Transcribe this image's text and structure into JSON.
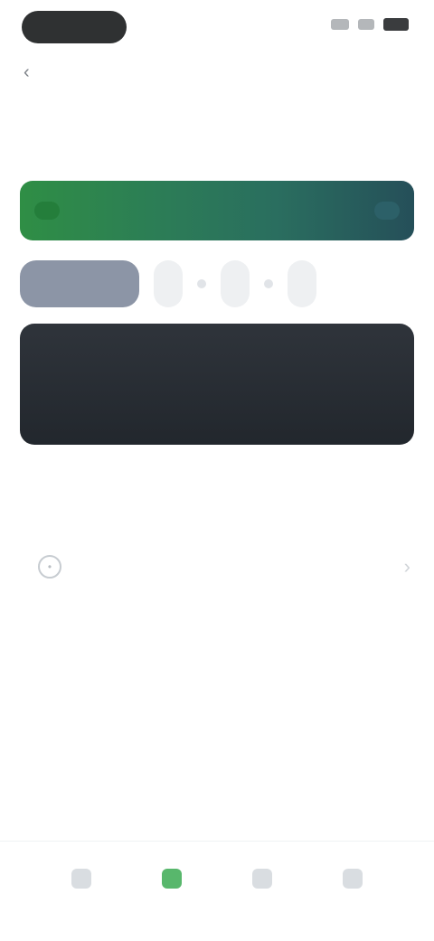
{
  "status_bar": {
    "time": "",
    "icons": [
      "signal-icon",
      "wifi-icon",
      "battery-icon"
    ]
  },
  "header": {
    "back_label": "",
    "title": ""
  },
  "promo": {
    "badge": "",
    "text": "",
    "cta": "",
    "colors": {
      "start": "#2f8e45",
      "end": "#254f59"
    }
  },
  "filters": {
    "chips": [
      {
        "label": "",
        "active": true
      },
      {
        "label": "",
        "active": false
      },
      {
        "label": "",
        "active": false
      },
      {
        "label": "",
        "active": false
      }
    ]
  },
  "feature_card": {
    "heading": "",
    "subtext": ""
  },
  "section": {
    "title": ""
  },
  "list": {
    "items": [
      {
        "title": "",
        "subtitle": "",
        "icon": "circle-icon"
      }
    ]
  },
  "bottom_nav": {
    "items": [
      {
        "label": "",
        "icon": "home-icon",
        "active": false
      },
      {
        "label": "",
        "icon": "explore-icon",
        "active": true
      },
      {
        "label": "",
        "icon": "activity-icon",
        "active": false
      },
      {
        "label": "",
        "icon": "profile-icon",
        "active": false
      }
    ],
    "accent": "#58b76c"
  }
}
